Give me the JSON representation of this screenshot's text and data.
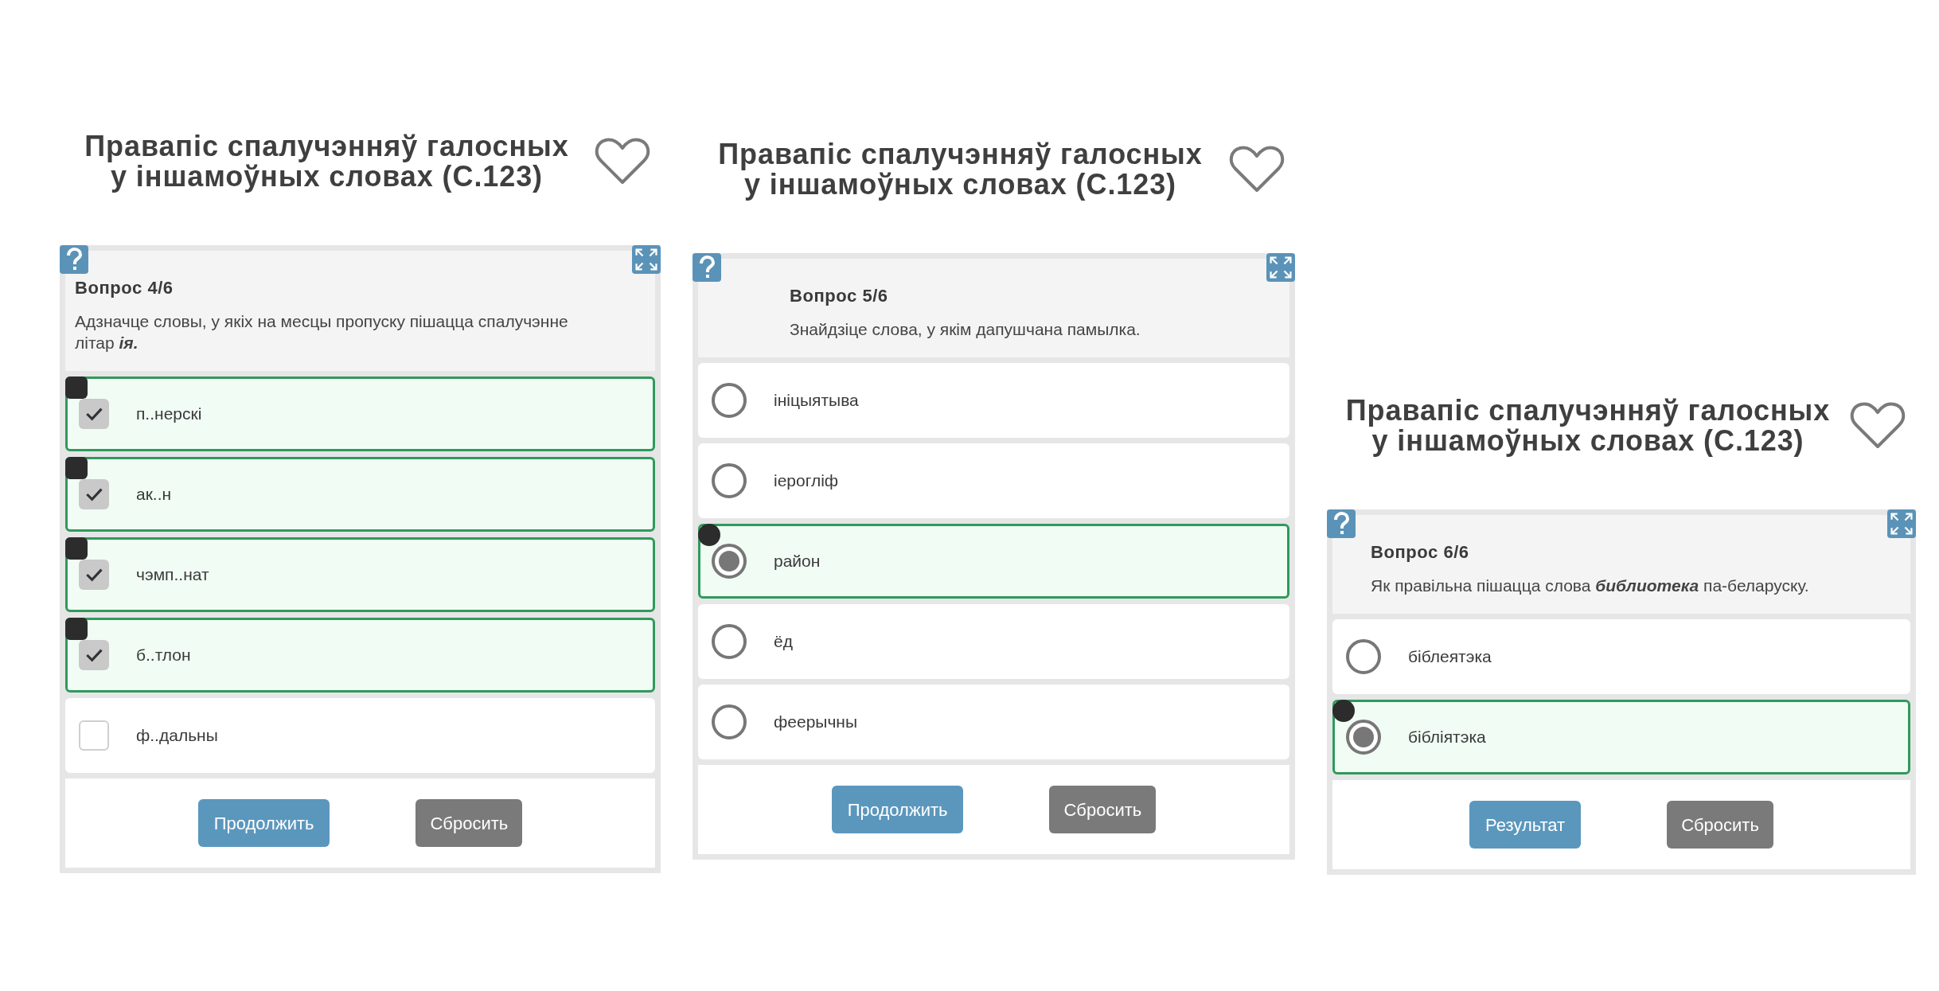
{
  "quizzes": [
    {
      "title": "Правапіс спалучэнняў галосных у іншамоўных словах (С.123)",
      "question_number": "Вопрос 4/6",
      "question": "Адзначце словы, у якіх на месцы пропуску пішацца спалучэнне літар  **ія.**",
      "kind": "checkbox",
      "options": [
        {
          "label": "п..нерскі",
          "selected": true
        },
        {
          "label": "ак..н",
          "selected": true
        },
        {
          "label": "чэмп..нат",
          "selected": true
        },
        {
          "label": "б..тлон",
          "selected": true
        },
        {
          "label": "ф..дальны",
          "selected": false
        }
      ],
      "buttons": [
        {
          "label": "Продолжить",
          "kind": "primary"
        },
        {
          "label": "Сбросить",
          "kind": "secondary"
        }
      ]
    },
    {
      "title": "Правапіс спалучэнняў галосных у іншамоўных словах (С.123)",
      "question_number": "Вопрос 5/6",
      "question": "Знайдзіце слова, у якім дапушчана памылка.",
      "kind": "radio",
      "options": [
        {
          "label": "ініцыятыва",
          "selected": false
        },
        {
          "label": "іерогліф",
          "selected": false
        },
        {
          "label": "район",
          "selected": true
        },
        {
          "label": "ёд",
          "selected": false
        },
        {
          "label": "феерычны",
          "selected": false
        }
      ],
      "buttons": [
        {
          "label": "Продолжить",
          "kind": "primary"
        },
        {
          "label": "Сбросить",
          "kind": "secondary"
        }
      ]
    },
    {
      "title": "Правапіс спалучэнняў галосных у іншамоўных словах (С.123)",
      "question_number": "Вопрос 6/6",
      "question": "Як правільна пішацца слова  **библиотека** па-беларуску.",
      "kind": "radio",
      "options": [
        {
          "label": "бiблеятэка",
          "selected": false
        },
        {
          "label": "бібліятэка",
          "selected": true
        }
      ],
      "buttons": [
        {
          "label": "Результат",
          "kind": "primary"
        },
        {
          "label": "Сбросить",
          "kind": "secondary"
        }
      ]
    }
  ]
}
